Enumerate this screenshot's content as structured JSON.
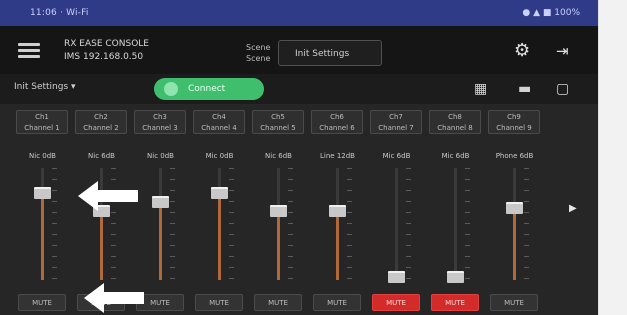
{
  "titlebar": {
    "left": "11:06 · Wi-Fi",
    "right": "● ▲ ■ 100%"
  },
  "header": {
    "line1": "RX EASE CONSOLE",
    "line2": "IMS 192.168.0.50",
    "scene_label_1": "Scene",
    "scene_label_2": "Scene",
    "scene_value": "Init Settings"
  },
  "toolbar": {
    "preset": "Init Settings ▾",
    "connect": "Connect"
  },
  "channels": [
    {
      "name1": "Ch1",
      "name2": "Channel 1",
      "db": "Nic 0dB",
      "level": 0.78,
      "mute": "MUTE",
      "muted": false
    },
    {
      "name1": "Ch2",
      "name2": "Channel 2",
      "db": "Nic 6dB",
      "level": 0.62,
      "mute": "MUTE",
      "muted": false
    },
    {
      "name1": "Ch3",
      "name2": "Channel 3",
      "db": "Nic 0dB",
      "level": 0.7,
      "mute": "MUTE",
      "muted": false
    },
    {
      "name1": "Ch4",
      "name2": "Channel 4",
      "db": "Mic 0dB",
      "level": 0.78,
      "mute": "MUTE",
      "muted": false
    },
    {
      "name1": "Ch5",
      "name2": "Channel 5",
      "db": "Nic 6dB",
      "level": 0.62,
      "mute": "MUTE",
      "muted": false
    },
    {
      "name1": "Ch6",
      "name2": "Channel 6",
      "db": "Line 12dB",
      "level": 0.62,
      "mute": "MUTE",
      "muted": false
    },
    {
      "name1": "Ch7",
      "name2": "Channel 7",
      "db": "Mic 6dB",
      "level": 0.03,
      "mute": "MUTE",
      "muted": true
    },
    {
      "name1": "Ch8",
      "name2": "Channel 8",
      "db": "Mic 6dB",
      "level": 0.03,
      "mute": "MUTE",
      "muted": true
    },
    {
      "name1": "Ch9",
      "name2": "Channel 9",
      "db": "Phone 6dB",
      "level": 0.64,
      "mute": "MUTE",
      "muted": false
    }
  ],
  "icons": {
    "menu": "menu-icon",
    "settings": "gear-icon",
    "exit": "exit-icon",
    "list": "list-icon",
    "minus": "minus-icon",
    "page": "page-icon",
    "next": "chevron-right-icon"
  },
  "colors": {
    "titlebar": "#2f3b86",
    "connect": "#3fbf6e",
    "mute_on": "#d32a2a",
    "fader_fill": "#b06a3a"
  },
  "annotations": {
    "arrow_color": "#ffffff"
  }
}
